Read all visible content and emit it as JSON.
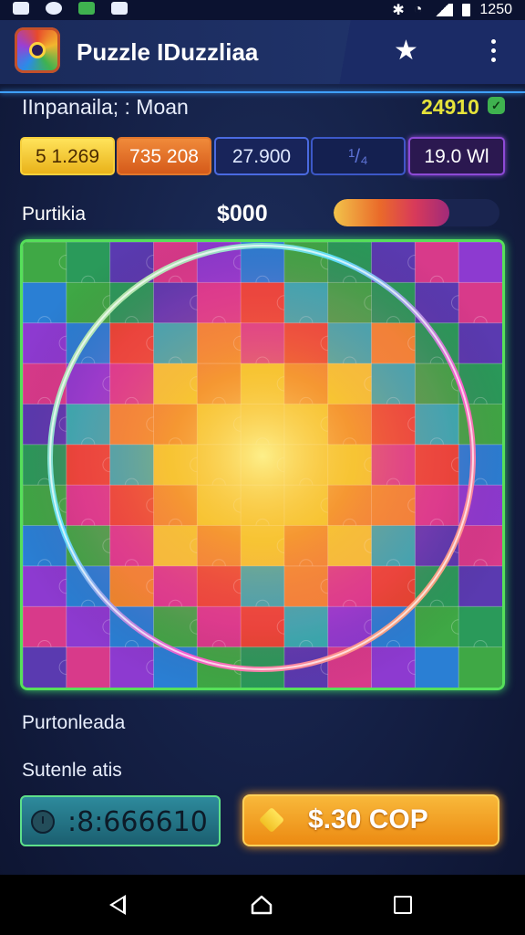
{
  "status_bar": {
    "time": "1250"
  },
  "header": {
    "title": "Puzzle IDuzzliaa"
  },
  "player": {
    "name": "IInpanaila; : Moan",
    "score": "24910",
    "score_badge": "✓"
  },
  "stats": [
    {
      "label": "5  1.269"
    },
    {
      "label": "735 208"
    },
    {
      "label": "27.900"
    },
    {
      "label": "¹/₄"
    },
    {
      "label": "19.0 Wl"
    }
  ],
  "progress": {
    "label": "Purtikia",
    "money": "$000",
    "fraction": 0.7
  },
  "board": {
    "palette": [
      "#3fa845",
      "#2a7fd4",
      "#8d3ad0",
      "#d83a8a",
      "#e8452f",
      "#f08a2a",
      "#f3cf2c",
      "#2fb0b0",
      "#5a3ab0",
      "#2a9a5a"
    ]
  },
  "section_a": "Purtonleada",
  "section_b": "Sutenle atis",
  "timer": {
    "value": ":8:666610"
  },
  "buy": {
    "label": "$.30 COP"
  }
}
